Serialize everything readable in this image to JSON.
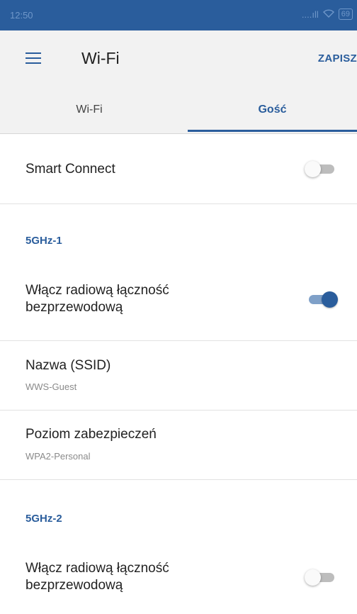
{
  "status_bar": {
    "time": "12:50",
    "signal": "....ıll",
    "wifi_icon": "wifi-icon",
    "battery": "69"
  },
  "app_bar": {
    "title": "Wi-Fi",
    "save_label": "ZAPISZ",
    "menu_icon": "hamburger-menu-icon"
  },
  "tabs": [
    {
      "label": "Wi-Fi",
      "active": false
    },
    {
      "label": "Gość",
      "active": true
    }
  ],
  "smart_connect": {
    "label": "Smart Connect",
    "enabled": false
  },
  "band_1": {
    "header": "5GHz-1",
    "radio": {
      "label_line1": "Włącz radiową łączność",
      "label_line2": "bezprzewodową",
      "enabled": true
    },
    "ssid": {
      "label": "Nazwa (SSID)",
      "value": "WWS-Guest"
    },
    "security": {
      "label": "Poziom zabezpieczeń",
      "value": "WPA2-Personal"
    }
  },
  "band_2": {
    "header": "5GHz-2",
    "radio": {
      "label_line1": "Włącz radiową łączność",
      "label_line2": "bezprzewodową",
      "enabled": false
    }
  },
  "colors": {
    "accent": "#2a5d9c",
    "toggle_off_track": "#bdbdbd",
    "toggle_on_track": "#7fa0c8"
  }
}
